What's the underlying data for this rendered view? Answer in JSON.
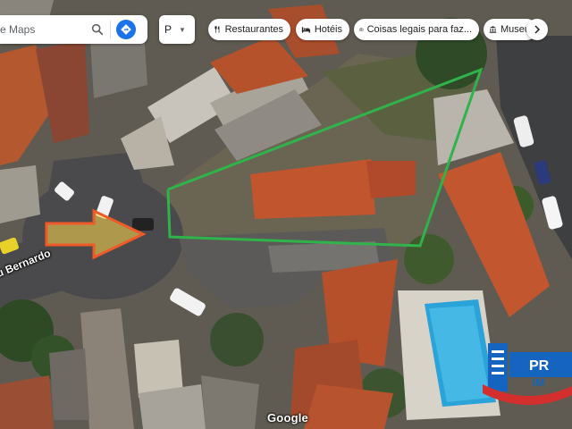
{
  "search": {
    "placeholder": "e Maps"
  },
  "language_select": {
    "value": "P"
  },
  "chips": [
    {
      "label": "Restaurantes",
      "icon": "restaurant-icon"
    },
    {
      "label": "Hotéis",
      "icon": "hotel-icon"
    },
    {
      "label": "Coisas legais para faz...",
      "icon": "camera-icon"
    },
    {
      "label": "Museu",
      "icon": "museum-icon"
    }
  ],
  "map": {
    "street_label": "u Bernardo",
    "logo": "Google",
    "boundary_color": "#2fb34a",
    "arrow_color": "#f05a28",
    "watermark_text": "PR... IM..."
  }
}
